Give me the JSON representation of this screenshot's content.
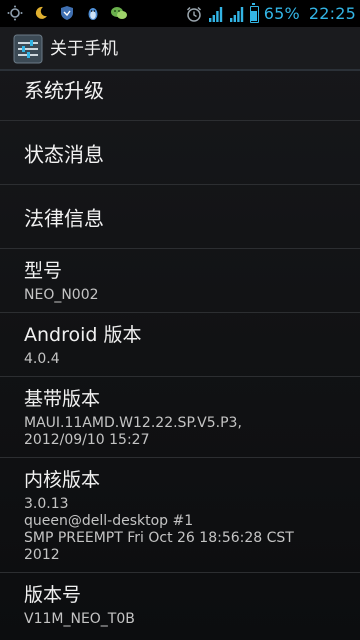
{
  "status_bar": {
    "battery_percent": "65%",
    "time": "22:25",
    "accent_color": "#33b5e5",
    "left_icons": [
      "brightness-icon",
      "moon-icon",
      "shield-icon",
      "qq-penguin-icon",
      "wechat-icon"
    ],
    "right_icons": [
      "alarm-icon",
      "signal-icon",
      "signal-icon",
      "battery-icon"
    ]
  },
  "action_bar": {
    "title": "关于手机",
    "icon": "settings-sliders-icon"
  },
  "items": {
    "system_update": {
      "label": "系统升级"
    },
    "status": {
      "label": "状态消息"
    },
    "legal": {
      "label": "法律信息"
    },
    "model": {
      "label": "型号",
      "value": "NEO_N002"
    },
    "android_version": {
      "label": "Android 版本",
      "value": "4.0.4"
    },
    "baseband": {
      "label": "基带版本",
      "value": "MAUI.11AMD.W12.22.SP.V5.P3,\n2012/09/10 15:27"
    },
    "kernel": {
      "label": "内核版本",
      "value": "3.0.13\nqueen@dell-desktop #1\nSMP PREEMPT Fri Oct 26 18:56:28 CST\n2012"
    },
    "build_number": {
      "label": "版本号",
      "value": "V11M_NEO_T0B"
    }
  }
}
